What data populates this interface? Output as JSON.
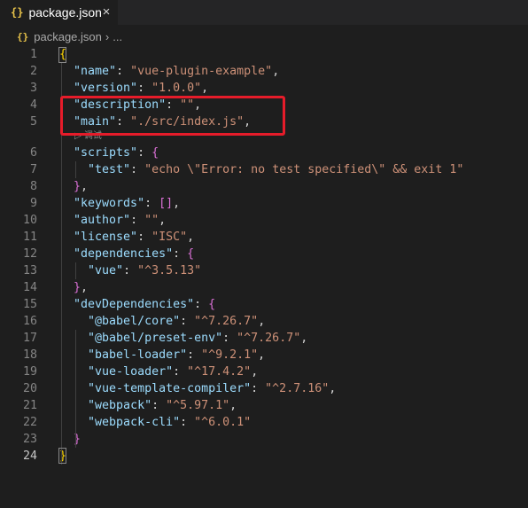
{
  "tab": {
    "icon": "{}",
    "label": "package.json",
    "close": "×"
  },
  "breadcrumb": {
    "icon": "{}",
    "file": "package.json",
    "separator": "›",
    "more": "..."
  },
  "codelens": "▷ 调试",
  "lines": [
    {
      "n": "1",
      "segs": [
        {
          "c": "b1",
          "t": "{"
        }
      ]
    },
    {
      "n": "2",
      "segs": [
        {
          "c": "p",
          "t": "  "
        },
        {
          "c": "k",
          "t": "\"name\""
        },
        {
          "c": "p",
          "t": ": "
        },
        {
          "c": "s",
          "t": "\"vue-plugin-example\""
        },
        {
          "c": "p",
          "t": ","
        }
      ]
    },
    {
      "n": "3",
      "segs": [
        {
          "c": "p",
          "t": "  "
        },
        {
          "c": "k",
          "t": "\"version\""
        },
        {
          "c": "p",
          "t": ": "
        },
        {
          "c": "s",
          "t": "\"1.0.0\""
        },
        {
          "c": "p",
          "t": ","
        }
      ]
    },
    {
      "n": "4",
      "segs": [
        {
          "c": "p",
          "t": "  "
        },
        {
          "c": "k",
          "t": "\"description\""
        },
        {
          "c": "p",
          "t": ": "
        },
        {
          "c": "s",
          "t": "\"\""
        },
        {
          "c": "p",
          "t": ","
        }
      ]
    },
    {
      "n": "5",
      "segs": [
        {
          "c": "p",
          "t": "  "
        },
        {
          "c": "k",
          "t": "\"main\""
        },
        {
          "c": "p",
          "t": ": "
        },
        {
          "c": "s",
          "t": "\"./src/index.js\""
        },
        {
          "c": "p",
          "t": ","
        }
      ]
    },
    {
      "n": "6",
      "segs": [
        {
          "c": "p",
          "t": "  "
        },
        {
          "c": "k",
          "t": "\"scripts\""
        },
        {
          "c": "p",
          "t": ": "
        },
        {
          "c": "b2",
          "t": "{"
        }
      ]
    },
    {
      "n": "7",
      "segs": [
        {
          "c": "p",
          "t": "    "
        },
        {
          "c": "k",
          "t": "\"test\""
        },
        {
          "c": "p",
          "t": ": "
        },
        {
          "c": "s",
          "t": "\"echo \\\"Error: no test specified\\\" && exit 1\""
        }
      ]
    },
    {
      "n": "8",
      "segs": [
        {
          "c": "p",
          "t": "  "
        },
        {
          "c": "b2",
          "t": "}"
        },
        {
          "c": "p",
          "t": ","
        }
      ]
    },
    {
      "n": "9",
      "segs": [
        {
          "c": "p",
          "t": "  "
        },
        {
          "c": "k",
          "t": "\"keywords\""
        },
        {
          "c": "p",
          "t": ": "
        },
        {
          "c": "b2",
          "t": "[]"
        },
        {
          "c": "p",
          "t": ","
        }
      ]
    },
    {
      "n": "10",
      "segs": [
        {
          "c": "p",
          "t": "  "
        },
        {
          "c": "k",
          "t": "\"author\""
        },
        {
          "c": "p",
          "t": ": "
        },
        {
          "c": "s",
          "t": "\"\""
        },
        {
          "c": "p",
          "t": ","
        }
      ]
    },
    {
      "n": "11",
      "segs": [
        {
          "c": "p",
          "t": "  "
        },
        {
          "c": "k",
          "t": "\"license\""
        },
        {
          "c": "p",
          "t": ": "
        },
        {
          "c": "s",
          "t": "\"ISC\""
        },
        {
          "c": "p",
          "t": ","
        }
      ]
    },
    {
      "n": "12",
      "segs": [
        {
          "c": "p",
          "t": "  "
        },
        {
          "c": "k",
          "t": "\"dependencies\""
        },
        {
          "c": "p",
          "t": ": "
        },
        {
          "c": "b2",
          "t": "{"
        }
      ]
    },
    {
      "n": "13",
      "segs": [
        {
          "c": "p",
          "t": "    "
        },
        {
          "c": "k",
          "t": "\"vue\""
        },
        {
          "c": "p",
          "t": ": "
        },
        {
          "c": "s",
          "t": "\"^3.5.13\""
        }
      ]
    },
    {
      "n": "14",
      "segs": [
        {
          "c": "p",
          "t": "  "
        },
        {
          "c": "b2",
          "t": "}"
        },
        {
          "c": "p",
          "t": ","
        }
      ]
    },
    {
      "n": "15",
      "segs": [
        {
          "c": "p",
          "t": "  "
        },
        {
          "c": "k",
          "t": "\"devDependencies\""
        },
        {
          "c": "p",
          "t": ": "
        },
        {
          "c": "b2",
          "t": "{"
        }
      ]
    },
    {
      "n": "16",
      "segs": [
        {
          "c": "p",
          "t": "    "
        },
        {
          "c": "k",
          "t": "\"@babel/core\""
        },
        {
          "c": "p",
          "t": ": "
        },
        {
          "c": "s",
          "t": "\"^7.26.7\""
        },
        {
          "c": "p",
          "t": ","
        }
      ]
    },
    {
      "n": "17",
      "segs": [
        {
          "c": "p",
          "t": "    "
        },
        {
          "c": "k",
          "t": "\"@babel/preset-env\""
        },
        {
          "c": "p",
          "t": ": "
        },
        {
          "c": "s",
          "t": "\"^7.26.7\""
        },
        {
          "c": "p",
          "t": ","
        }
      ]
    },
    {
      "n": "18",
      "segs": [
        {
          "c": "p",
          "t": "    "
        },
        {
          "c": "k",
          "t": "\"babel-loader\""
        },
        {
          "c": "p",
          "t": ": "
        },
        {
          "c": "s",
          "t": "\"^9.2.1\""
        },
        {
          "c": "p",
          "t": ","
        }
      ]
    },
    {
      "n": "19",
      "segs": [
        {
          "c": "p",
          "t": "    "
        },
        {
          "c": "k",
          "t": "\"vue-loader\""
        },
        {
          "c": "p",
          "t": ": "
        },
        {
          "c": "s",
          "t": "\"^17.4.2\""
        },
        {
          "c": "p",
          "t": ","
        }
      ]
    },
    {
      "n": "20",
      "segs": [
        {
          "c": "p",
          "t": "    "
        },
        {
          "c": "k",
          "t": "\"vue-template-compiler\""
        },
        {
          "c": "p",
          "t": ": "
        },
        {
          "c": "s",
          "t": "\"^2.7.16\""
        },
        {
          "c": "p",
          "t": ","
        }
      ]
    },
    {
      "n": "21",
      "segs": [
        {
          "c": "p",
          "t": "    "
        },
        {
          "c": "k",
          "t": "\"webpack\""
        },
        {
          "c": "p",
          "t": ": "
        },
        {
          "c": "s",
          "t": "\"^5.97.1\""
        },
        {
          "c": "p",
          "t": ","
        }
      ]
    },
    {
      "n": "22",
      "segs": [
        {
          "c": "p",
          "t": "    "
        },
        {
          "c": "k",
          "t": "\"webpack-cli\""
        },
        {
          "c": "p",
          "t": ": "
        },
        {
          "c": "s",
          "t": "\"^6.0.1\""
        }
      ]
    },
    {
      "n": "23",
      "segs": [
        {
          "c": "p",
          "t": "  "
        },
        {
          "c": "b2",
          "t": "}"
        }
      ]
    },
    {
      "n": "24",
      "segs": [
        {
          "c": "b1",
          "t": "}"
        }
      ]
    }
  ],
  "active_line": "24",
  "colors": {
    "highlight_box": "#e61c2a",
    "json_key": "#9cdcfe",
    "json_string": "#ce9178",
    "bracket_outer": "#ffd700",
    "bracket_inner": "#da70d6"
  }
}
